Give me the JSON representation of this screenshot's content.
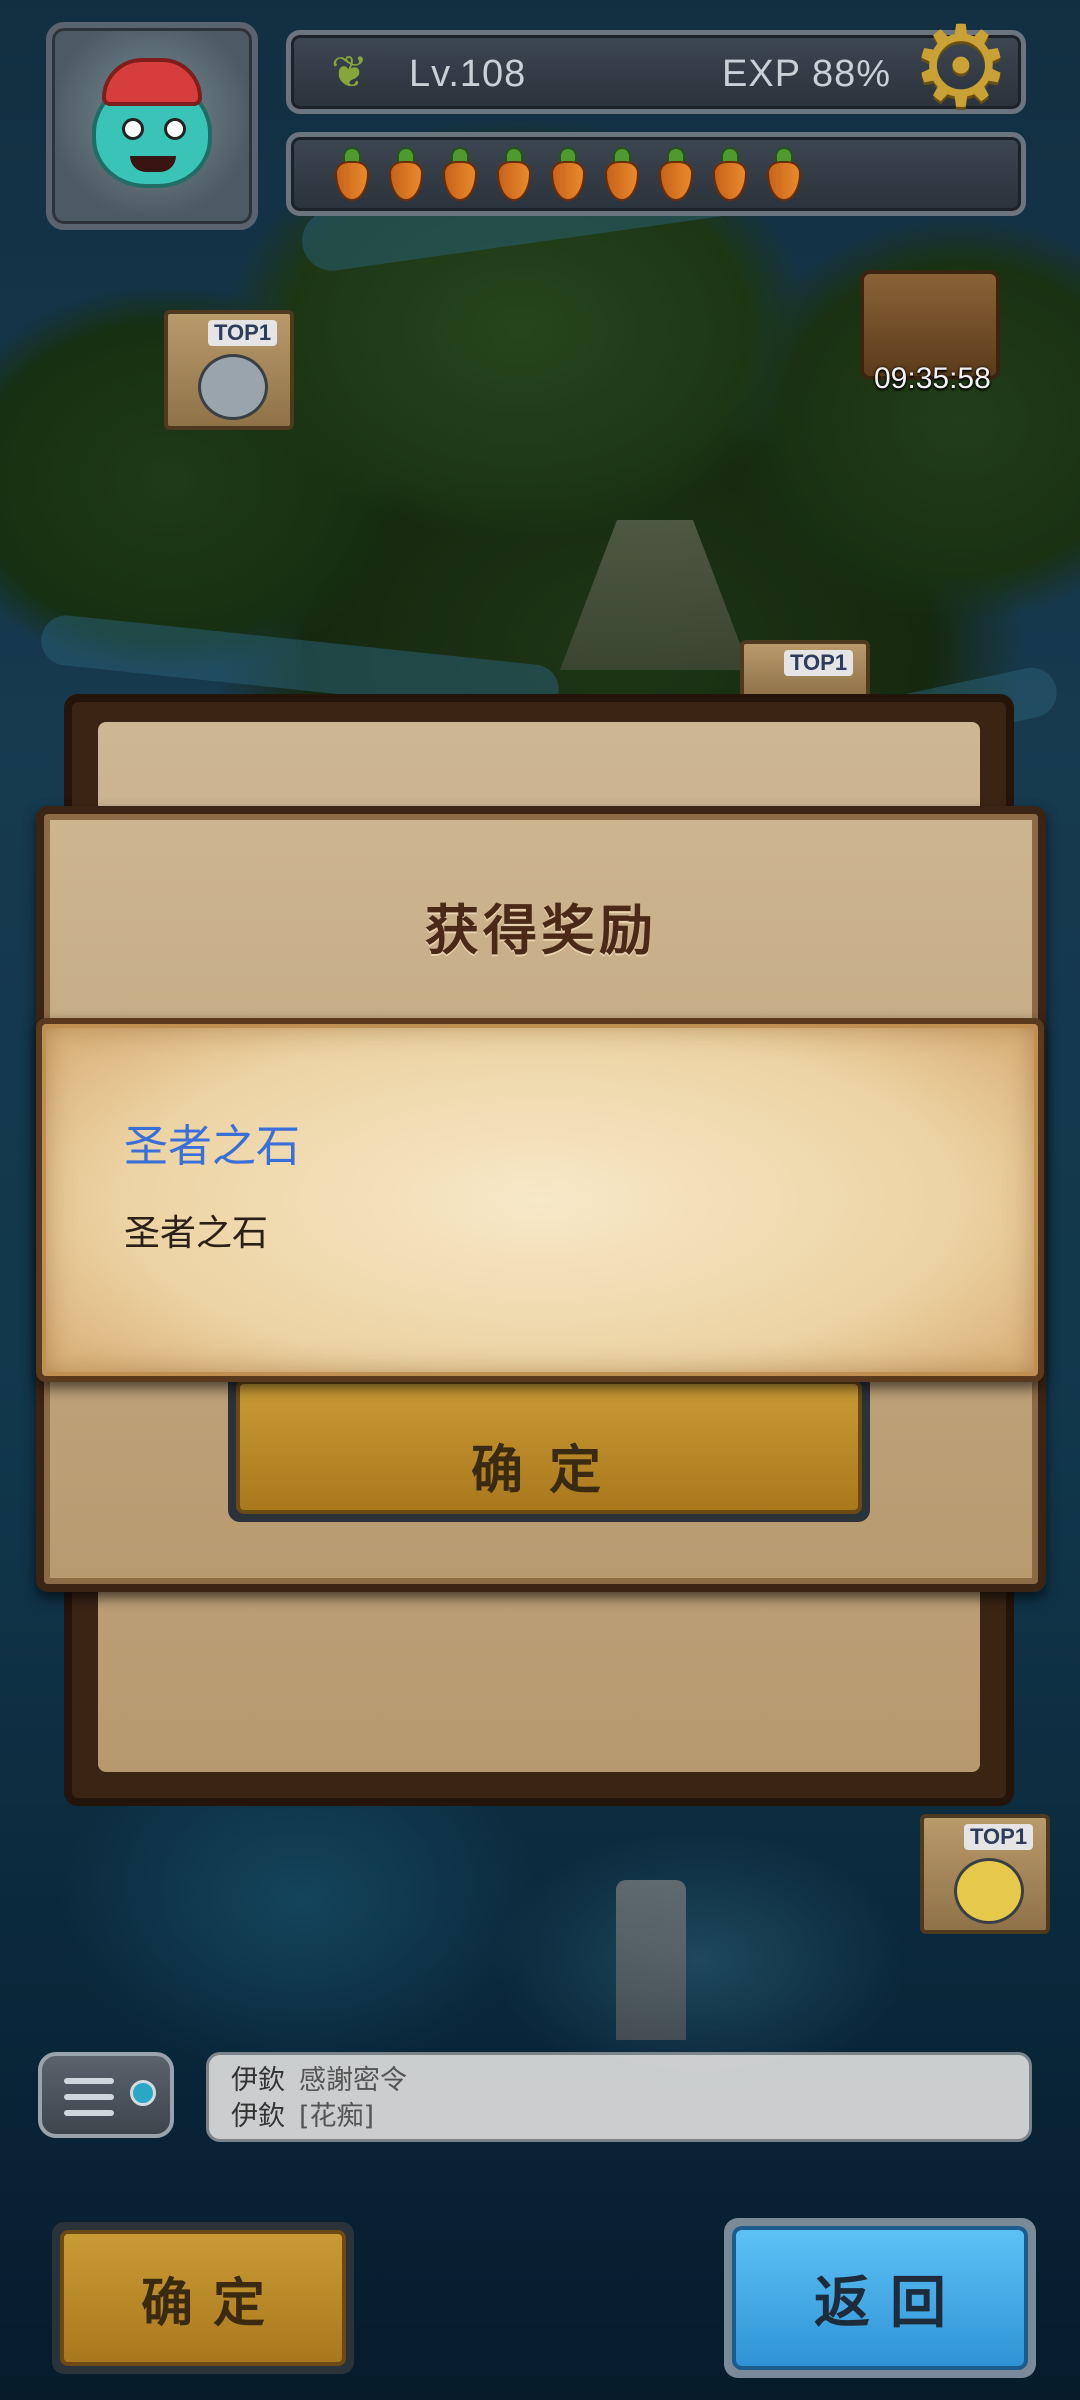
{
  "hud": {
    "level": "Lv.108",
    "exp": "EXP  88%",
    "carrot_count": 9,
    "level_icon": "tree-icon",
    "settings_icon": "gear-icon"
  },
  "map": {
    "top_badge": "TOP1",
    "timer": "09:35:58"
  },
  "dialog_back": {
    "title": "获得奖励",
    "confirm_label": "确定"
  },
  "popup": {
    "item_name": "圣者之石",
    "item_desc": "圣者之石"
  },
  "chat": {
    "messages": [
      {
        "name": "伊欽",
        "text": "感謝密令"
      },
      {
        "name": "伊欽",
        "text": "[花痴]"
      }
    ]
  },
  "bottom": {
    "confirm_label": "确定",
    "back_label": "返回"
  },
  "colors": {
    "item_title": "#3a6fd8",
    "confirm_gold": "#c99b34",
    "back_blue": "#3fa8e6"
  }
}
